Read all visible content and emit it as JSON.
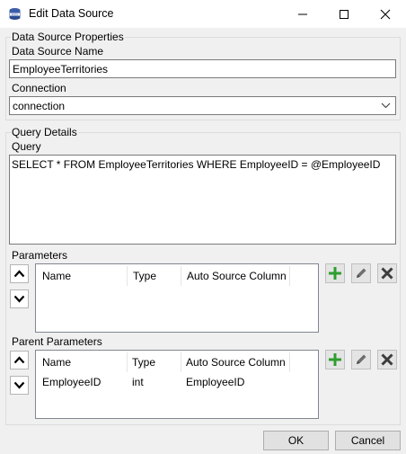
{
  "window": {
    "title": "Edit Data Source",
    "icon": "database-icon"
  },
  "props": {
    "group_label": "Data Source Properties",
    "name_label": "Data Source Name",
    "name_value": "EmployeeTerritories",
    "connection_label": "Connection",
    "connection_value": "connection"
  },
  "query": {
    "group_label": "Query Details",
    "label": "Query",
    "text": "SELECT * FROM EmployeeTerritories WHERE EmployeeID = @EmployeeID"
  },
  "parameters": {
    "label": "Parameters",
    "columns": [
      "Name",
      "Type",
      "Auto Source Column"
    ],
    "rows": []
  },
  "parent_parameters": {
    "label": "Parent Parameters",
    "columns": [
      "Name",
      "Type",
      "Auto Source Column"
    ],
    "rows": [
      {
        "name": "EmployeeID",
        "type": "int",
        "auto": "EmployeeID"
      }
    ]
  },
  "buttons": {
    "ok": "OK",
    "cancel": "Cancel"
  },
  "colors": {
    "add": "#2e9e2e",
    "edit": "#6e6e6e",
    "delete": "#3c3c3c"
  }
}
